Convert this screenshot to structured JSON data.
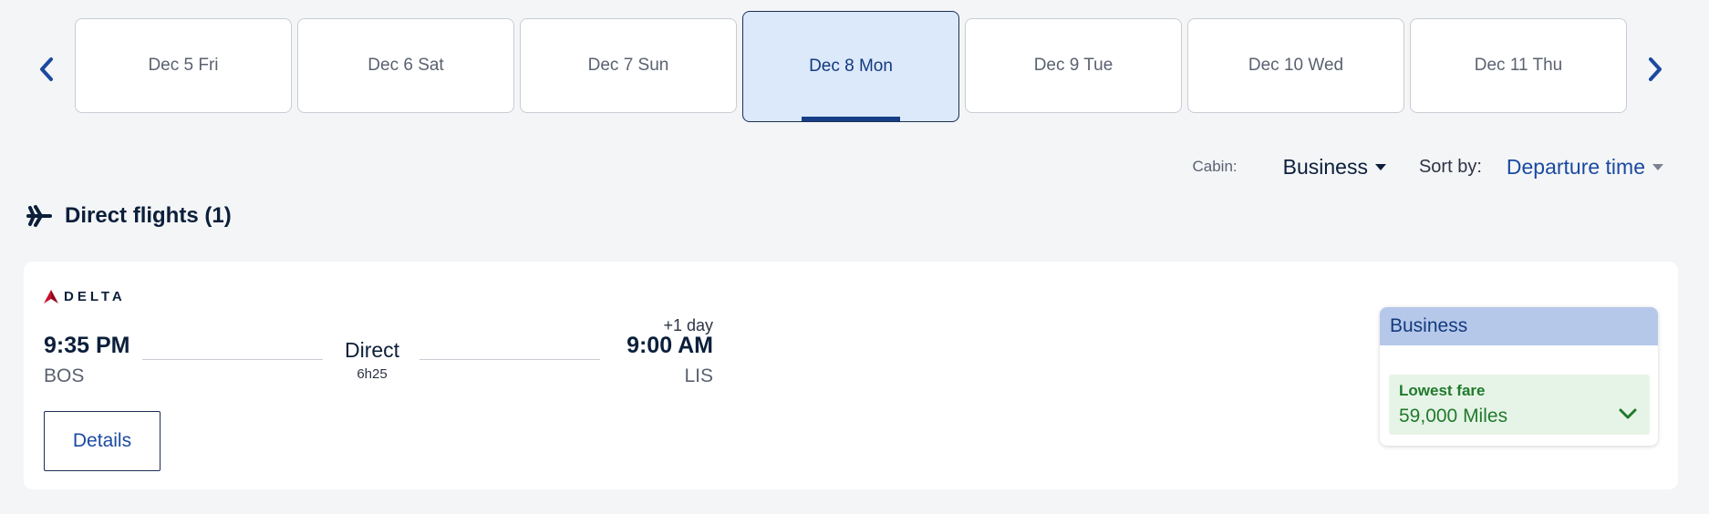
{
  "date_nav": {
    "prev_icon": "chevron-left-icon",
    "next_icon": "chevron-right-icon",
    "dates": [
      {
        "label": "Dec 5 Fri",
        "selected": false
      },
      {
        "label": "Dec 6 Sat",
        "selected": false
      },
      {
        "label": "Dec 7 Sun",
        "selected": false
      },
      {
        "label": "Dec 8 Mon",
        "selected": true
      },
      {
        "label": "Dec 9 Tue",
        "selected": false
      },
      {
        "label": "Dec 10 Wed",
        "selected": false
      },
      {
        "label": "Dec 11 Thu",
        "selected": false
      }
    ]
  },
  "filters": {
    "cabin_label": "Cabin:",
    "cabin_value": "Business",
    "sort_label": "Sort by:",
    "sort_value": "Departure time"
  },
  "section": {
    "icon": "airplane-icon",
    "title": "Direct flights (1)"
  },
  "flight": {
    "airline": "DELTA",
    "departure_time": "9:35 PM",
    "departure_airport": "BOS",
    "stops": "Direct",
    "duration": "6h25",
    "day_offset": "+1 day",
    "arrival_time": "9:00 AM",
    "arrival_airport": "LIS",
    "details_label": "Details",
    "fare": {
      "cabin": "Business",
      "tag": "Lowest fare",
      "price": "59,000 Miles",
      "expand_icon": "chevron-down-icon"
    }
  },
  "colors": {
    "background": "#f4f5f7",
    "accent_blue": "#1b4aa0",
    "selected_date_bg": "#dce9fb",
    "fare_header_bg": "#b6c8ea",
    "fare_option_bg": "#e6f4e8",
    "fare_green": "#207a2a",
    "delta_red": "#c8102e"
  }
}
